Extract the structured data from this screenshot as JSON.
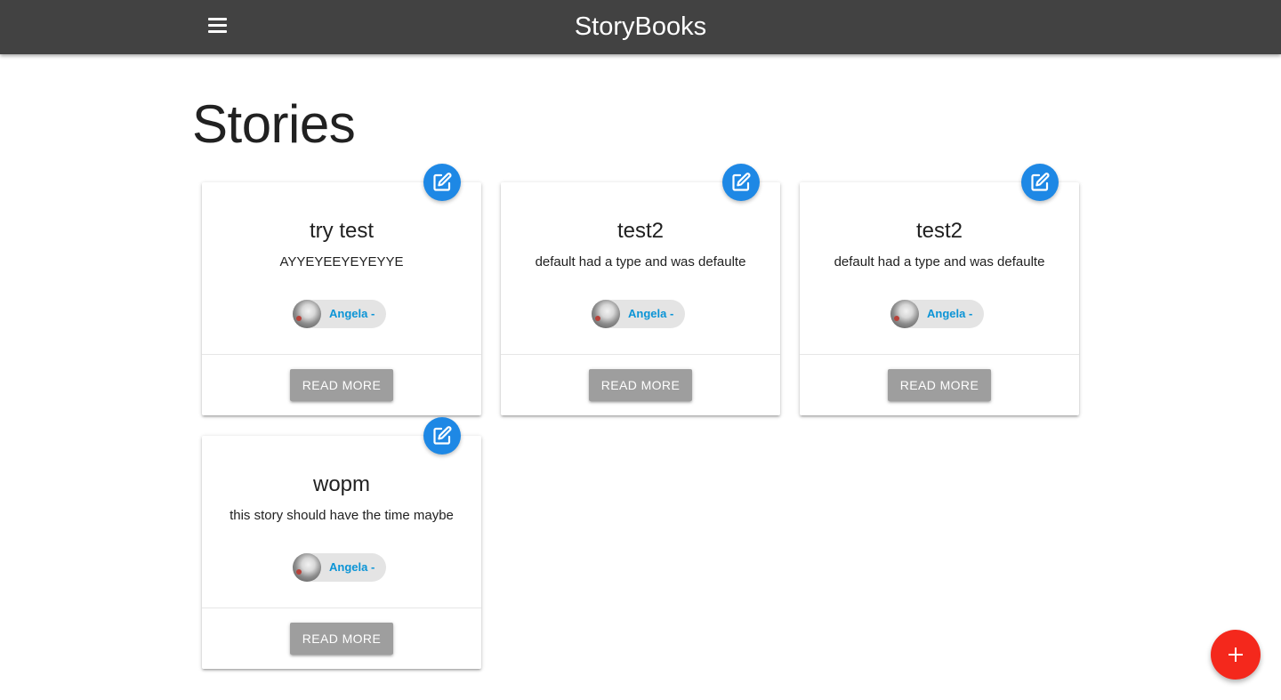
{
  "navbar": {
    "brand": "StoryBooks",
    "menu_icon": "hamburger-menu-icon"
  },
  "page": {
    "title": "Stories"
  },
  "stories": [
    {
      "title": "try test",
      "body": "AYYEYEEYEYEYYE",
      "author": "Angela -",
      "read_more": "Read More",
      "edit_icon": "edit-icon"
    },
    {
      "title": "test2",
      "body": "default had a type and was defaulte",
      "author": "Angela -",
      "read_more": "Read More",
      "edit_icon": "edit-icon"
    },
    {
      "title": "test2",
      "body": "default had a type and was defaulte",
      "author": "Angela -",
      "read_more": "Read More",
      "edit_icon": "edit-icon"
    },
    {
      "title": "wopm",
      "body": "this story should have the time maybe",
      "author": "Angela -",
      "read_more": "Read More",
      "edit_icon": "edit-icon"
    }
  ],
  "fab": {
    "icon": "add-icon"
  },
  "colors": {
    "navbar": "#424242",
    "edit_button": "#1e88e5",
    "fab": "#f4281c",
    "chip_text": "#0b94d6",
    "read_more_button": "#9e9e9e"
  }
}
